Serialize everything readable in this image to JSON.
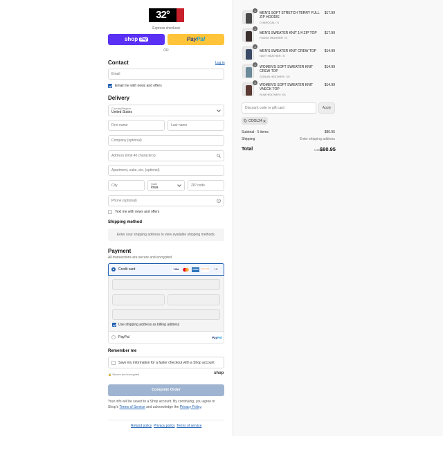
{
  "brand": {
    "logo_text": "32°",
    "colors": {
      "black": "#000000",
      "red": "#c8202b"
    }
  },
  "express": {
    "title": "Express checkout",
    "shop_pay_label": "shop",
    "shop_pay_badge": "Pay",
    "paypal_label_a": "Pay",
    "paypal_label_b": "Pal",
    "or_label": "OR"
  },
  "contact": {
    "heading": "Contact",
    "login_link": "Log in",
    "email_placeholder": "Email",
    "newsletter_label": "Email me with news and offers",
    "newsletter_checked": true
  },
  "delivery": {
    "heading": "Delivery",
    "country_label": "Country/Region",
    "country_value": "United States",
    "first_name_placeholder": "First name",
    "last_name_placeholder": "Last name",
    "company_placeholder": "Company (optional)",
    "address_placeholder": "Address (limit 40 characters)",
    "apartment_placeholder": "Apartment, suite, etc. (optional)",
    "city_placeholder": "City",
    "state_label": "State",
    "state_value": "Iowa",
    "zip_placeholder": "ZIP code",
    "phone_placeholder": "Phone (optional)",
    "text_offers_label": "Text me with news and offers",
    "text_offers_checked": false
  },
  "shipping_method": {
    "heading": "Shipping method",
    "message": "Enter your shipping address to view available shipping methods."
  },
  "payment": {
    "heading": "Payment",
    "subtitle": "All transactions are secure and encrypted.",
    "credit_card_label": "Credit card",
    "card_brands": [
      "VISA",
      "MC",
      "AMEX",
      "DISCOVER"
    ],
    "more_brands": "+4",
    "billing_same_label": "Use shipping address as billing address",
    "billing_same_checked": true,
    "paypal_option_label": "PayPal",
    "paypal_logo_a": "Pay",
    "paypal_logo_b": "Pal"
  },
  "remember": {
    "heading": "Remember me",
    "save_label": "Save my information for a faster checkout with a Shop account",
    "secure_label": "Secure and encrypted",
    "shop_logo": "shop"
  },
  "complete_button": "Complete Order",
  "legal": {
    "text_a": "Your info will be saved to a Shop account. By continuing, you agree to Shop's",
    "terms_link": "Terms of Service",
    "text_b": "and acknowledge the",
    "privacy_link": "Privacy Policy",
    "text_c": "."
  },
  "footer": {
    "refund": "Refund policy",
    "privacy": "Privacy policy",
    "terms": "Terms of service"
  },
  "order": {
    "items": [
      {
        "qty": "1",
        "name": "MEN'S SOFT STRETCH TERRY FULL ZIP HOODIE",
        "variant": "CHARCOAL / S",
        "price": "$17.99",
        "color": "#4a4a4a"
      },
      {
        "qty": "1",
        "name": "MEN'S SWEATER KNIT 1/4 ZIP TOP",
        "variant": "FUDGE HEATHER / S",
        "price": "$17.99",
        "color": "#3a2f2c"
      },
      {
        "qty": "1",
        "name": "MEN'S SWEATER KNIT CREW TOP",
        "variant": "NAVY HEATHER / S",
        "price": "$14.99",
        "color": "#3b4a66"
      },
      {
        "qty": "1",
        "name": "WOMEN'S SOFT SWEATER KNIT CREW TOP",
        "variant": "GOBLIN HEATHER / XS",
        "price": "$14.99",
        "color": "#6a8a9a"
      },
      {
        "qty": "1",
        "name": "WOMEN'S SOFT SWEATER KNIT VNECK TOP",
        "variant": "RUM HEATHER / XS",
        "price": "$14.99",
        "color": "#5a3a33"
      }
    ],
    "discount_placeholder": "Discount code or gift card",
    "apply_label": "Apply",
    "discount_tag": "COOL24",
    "subtotal_label": "Subtotal · 5 items",
    "subtotal_value": "$80.95",
    "shipping_label": "Shipping",
    "shipping_value": "Enter shipping address",
    "total_label": "Total",
    "currency": "USD",
    "total_value": "$80.95"
  }
}
